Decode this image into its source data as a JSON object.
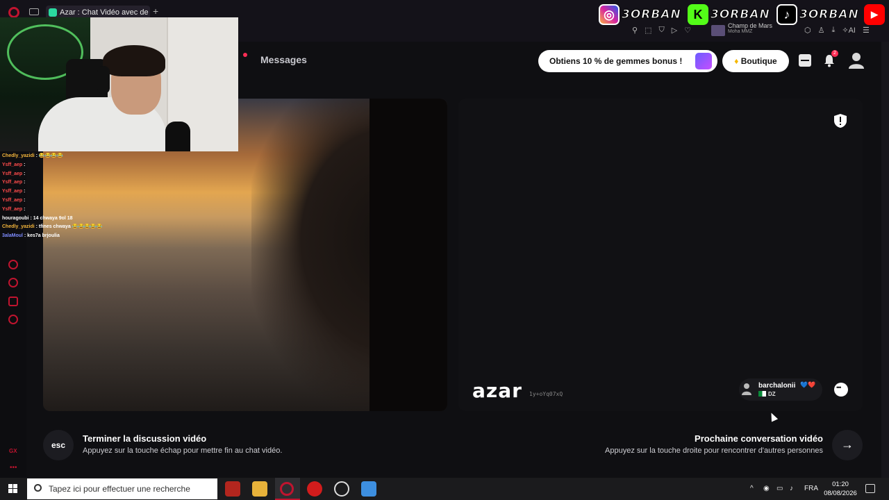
{
  "browser": {
    "tab_title": "Azar : Chat Vidéo avec de n",
    "new_tab_symbol": "+",
    "music": {
      "title": "Champ de Mars",
      "artist": "Moha MMZ"
    },
    "ai_label": "AI"
  },
  "social_overlay": [
    {
      "platform": "instagram-icon",
      "handle": "3ORBAN",
      "color": "#d6249f"
    },
    {
      "platform": "kick-icon",
      "glyph": "K",
      "handle": "3ORBAN",
      "color": "#53fc18"
    },
    {
      "platform": "tiktok-icon",
      "glyph": "♪",
      "handle": "3ORBAN",
      "color": "#000000"
    },
    {
      "platform": "youtube-icon",
      "glyph": "▶",
      "color": "#ff0000"
    }
  ],
  "nav": {
    "messages": "Messages"
  },
  "header": {
    "promo_label": "Obtiens 10 % de gemmes bonus !",
    "shop_label": "Boutique",
    "notification_count": "2"
  },
  "video": {
    "logo": "azar",
    "session_id": "1y+oYq07xQ",
    "partner": {
      "name": "barchalonii",
      "hearts": "💙❤️",
      "country": "DZ"
    }
  },
  "actions": {
    "end": {
      "key": "esc",
      "title": "Terminer la discussion vidéo",
      "subtitle": "Appuyez sur la touche échap pour mettre fin au chat vidéo."
    },
    "next": {
      "key": "→",
      "title": "Prochaine conversation vidéo",
      "subtitle": "Appuyez sur la touche droite pour rencontrer d'autres personnes"
    }
  },
  "sidebar": {
    "gx_label": "GX",
    "more": "•••"
  },
  "chat": [
    {
      "user": "Chedly_yazidi",
      "text": ": 😂😂😂😂",
      "color": "#f6b73c"
    },
    {
      "user": "Ysff_aep",
      "text": ":",
      "color": "#ff4b4b"
    },
    {
      "user": "Ysff_aep",
      "text": ":",
      "color": "#ff4b4b"
    },
    {
      "user": "Ysff_aep",
      "text": ":",
      "color": "#ff4b4b"
    },
    {
      "user": "Ysff_aep",
      "text": ":",
      "color": "#ff4b4b"
    },
    {
      "user": "Ysff_aep",
      "text": ":",
      "color": "#ff4b4b"
    },
    {
      "user": "Ysff_aep",
      "text": ":",
      "color": "#ff4b4b"
    },
    {
      "user": "houragoubi",
      "text": ": 14 chwaya 9ol 18",
      "color": "#ffffff"
    },
    {
      "user": "Chedly_yazidi",
      "text": ": tfines chwaya 😂😂😂😂😂",
      "color": "#f6b73c"
    },
    {
      "user": "3alaMoul",
      "text": ": kes7a brjoulia",
      "color": "#7e8cff"
    }
  ],
  "taskbar": {
    "search_placeholder": "Tapez ici pour effectuer une recherche",
    "language": "FRA",
    "time": "01:20",
    "date": "08/08/2026"
  },
  "colors": {
    "accent": "#c0142f",
    "background": "#0f0f12",
    "badge": "#ff2d55"
  }
}
